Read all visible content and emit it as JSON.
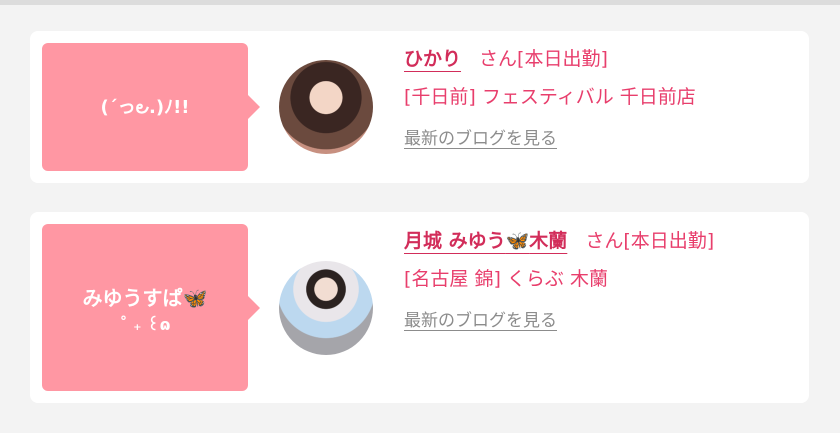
{
  "entries": [
    {
      "bubble_text": "(´っ౿.)ﾉ!!",
      "bubble_sub": "",
      "name": "ひかり",
      "san": "さん",
      "status": "[本日出勤]",
      "shop": "[千日前] フェスティバル 千日前店",
      "blog_link": "最新のブログを見る"
    },
    {
      "bubble_text": "みゆうすぱ",
      "bubble_emoji": "🦋",
      "bubble_sub": "˚ ₊ ꒰ɷ",
      "name_part1": "月城 みゆう",
      "name_emoji": "🦋",
      "name_part2": "木蘭",
      "san": "さん",
      "status": "[本日出勤]",
      "shop": "[名古屋 錦] くらぶ 木蘭",
      "blog_link": "最新のブログを見る"
    }
  ],
  "colors": {
    "accent": "#ff97a3",
    "text_pink": "#e83e6c",
    "link_gray": "#8c8c8c"
  }
}
